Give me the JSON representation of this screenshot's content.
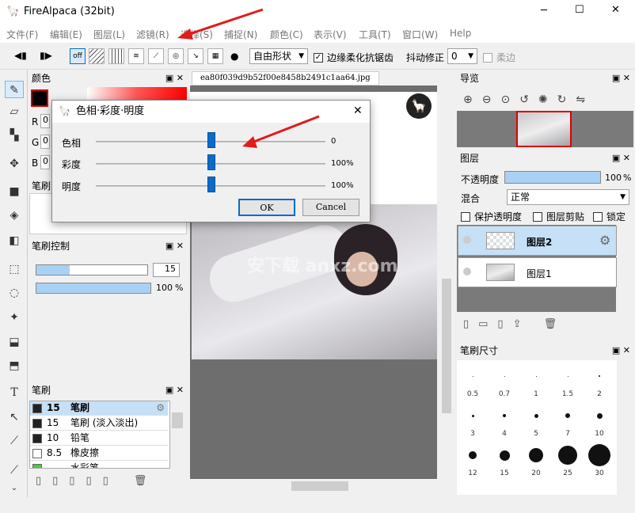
{
  "window": {
    "title": "FireAlpaca (32bit)",
    "minimize": "─",
    "maximize": "☐",
    "close": "✕"
  },
  "menu": [
    "文件(F)",
    "编辑(E)",
    "图层(L)",
    "滤镜(R)",
    "选择(S)",
    "捕捉(N)",
    "颜色(C)",
    "表示(V)",
    "工具(T)",
    "窗口(W)",
    "Help"
  ],
  "toolbar": {
    "off_label": "off",
    "shape_select": "自由形状",
    "antialias_label": "边缘柔化抗锯齿",
    "antialias_checked": true,
    "stabilizer_label": "抖动修正",
    "stabilizer_value": "0",
    "soft_label": "柔边"
  },
  "color_panel": {
    "title": "颜色",
    "r_label": "R",
    "r_value": "0",
    "g_label": "G",
    "g_value": "0",
    "b_label": "B",
    "b_value": "0"
  },
  "brush_partial_title": "笔刷",
  "brush_control": {
    "title": "笔刷控制",
    "size_value": "15",
    "opacity_value": "100",
    "opacity_unit": "%"
  },
  "brush_panel": {
    "title": "笔刷",
    "items": [
      {
        "size": "15",
        "name": "笔刷",
        "selected": true
      },
      {
        "size": "15",
        "name": "笔刷 (淡入淡出)",
        "selected": false
      },
      {
        "size": "10",
        "name": "铅笔",
        "selected": false
      },
      {
        "size": "8.5",
        "name": "橡皮擦",
        "selected": false
      },
      {
        "size": "",
        "name": "水彩笔",
        "selected": false
      }
    ]
  },
  "document": {
    "tab": "ea80f039d9b52f00e8458b2491c1aa64.jpg",
    "watermark": "安下载 anxz.com"
  },
  "dialog": {
    "title": "色相·彩度·明度",
    "rows": [
      {
        "label": "色相",
        "value": "0",
        "level": 0.5
      },
      {
        "label": "彩度",
        "value": "100%",
        "level": 0.5
      },
      {
        "label": "明度",
        "value": "100%",
        "level": 0.5
      }
    ],
    "ok": "OK",
    "cancel": "Cancel"
  },
  "navigator": {
    "title": "导览"
  },
  "layers": {
    "title": "图层",
    "opacity_label": "不透明度",
    "opacity_value": "100",
    "opacity_unit": "%",
    "blend_label": "混合",
    "blend_value": "正常",
    "protect_label": "保护透明度",
    "clip_label": "图层剪贴",
    "lock_label": "锁定",
    "items": [
      {
        "name": "图层2",
        "selected": true
      },
      {
        "name": "图层1",
        "selected": false
      }
    ]
  },
  "brush_size": {
    "title": "笔刷尺寸",
    "sizes": [
      "0.5",
      "0.7",
      "1",
      "1.5",
      "2",
      "3",
      "4",
      "5",
      "7",
      "10",
      "12",
      "15",
      "20",
      "25",
      "30"
    ]
  },
  "colors": {
    "accent": "#0a6bc9",
    "selection": "#c5e0f7",
    "bar": "#a9d1f5"
  }
}
